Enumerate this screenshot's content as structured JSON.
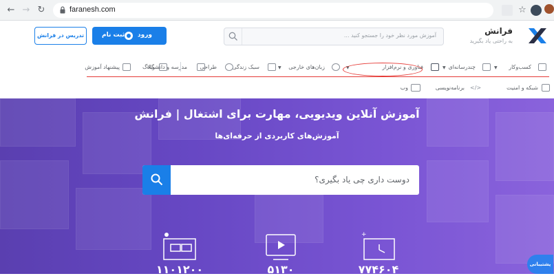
{
  "browser": {
    "url": "faranesh.com"
  },
  "header": {
    "logo_title": "فرانش",
    "logo_subtitle": "به راحتی یاد بگیرید",
    "search_placeholder": "آموزش مورد نظر خود را جستجو کنید ...",
    "login_label": "ورود",
    "register_label": "ثبت نام",
    "teach_label": "تدریس در فرانش"
  },
  "categories": {
    "row1": [
      {
        "label": "کسب‌وکار",
        "icon": "briefcase-icon"
      },
      {
        "label": "چندرسانه‌ای",
        "icon": "media-icon"
      },
      {
        "label": "فناوری و نرم‌افزار",
        "icon": "monitor-icon"
      },
      {
        "label": "زبان‌های خارجی",
        "icon": "globe-icon"
      },
      {
        "label": "سبک زندگی",
        "icon": "lifestyle-icon"
      },
      {
        "label": "طراحی",
        "icon": "palette-icon"
      },
      {
        "label": "مدرسه و دانشگاه",
        "icon": "graduation-icon"
      },
      {
        "label": "وبلاگ",
        "icon": "blog-icon"
      },
      {
        "label": "پیشنهاد آموزش",
        "icon": "suggest-icon"
      }
    ],
    "row2": [
      {
        "label": "شبکه و امنیت",
        "icon": "network-icon"
      },
      {
        "label": "برنامه‌نویسی",
        "icon": "code-icon"
      },
      {
        "label": "وب",
        "icon": "web-icon"
      }
    ]
  },
  "hero": {
    "title": "آموزش آنلاین ویدیویی، مهارت برای اشتغال | فرانش",
    "subtitle": "آموزش‌های کاربردی از حرفه‌ای‌ها",
    "search_placeholder": "دوست داری چی یاد بگیری؟",
    "stats": [
      "۱۱۰۱۲۰۰",
      "۵۱۳۰",
      "۷۷۴۶۰۴"
    ]
  },
  "support_label": "پشتیبانی",
  "colors": {
    "accent": "#1a7fe8",
    "hero_start": "#5a3fb0",
    "hero_end": "#8a63dc",
    "highlight": "#e53935"
  }
}
